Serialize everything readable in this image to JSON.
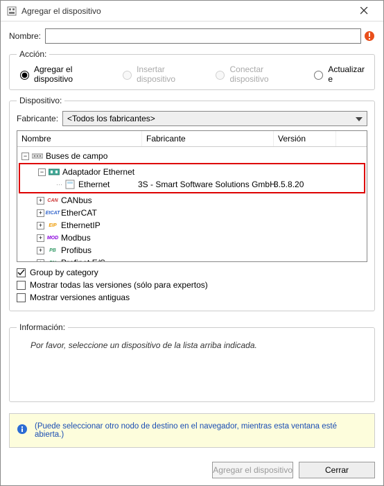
{
  "window": {
    "title": "Agregar el dispositivo"
  },
  "name": {
    "label": "Nombre:",
    "value": ""
  },
  "action": {
    "legend": "Acción:",
    "add": "Agregar el dispositivo",
    "insert": "Insertar dispositivo",
    "connect": "Conectar dispositivo",
    "update": "Actualizar e"
  },
  "device": {
    "legend": "Dispositivo:",
    "vendor_label": "Fabricante:",
    "vendor_value": "<Todos los fabricantes>",
    "cols": {
      "name": "Nombre",
      "vendor": "Fabricante",
      "version": "Versión"
    },
    "root": "Buses de campo",
    "eth_adapter": "Adaptador Ethernet",
    "eth": {
      "name": "Ethernet",
      "vendor": "3S - Smart Software Solutions GmbH",
      "version": "3.5.8.20"
    },
    "items": [
      "CANbus",
      "EtherCAT",
      "EthernetIP",
      "Modbus",
      "Profibus",
      "Profinet E/S"
    ],
    "icons": [
      "CAN",
      "EtCAT",
      "EIP",
      "MOD",
      "PB",
      "PN"
    ]
  },
  "checks": {
    "group": "Group by category",
    "allver": "Mostrar todas las versiones (sólo para expertos)",
    "oldver": "Mostrar versiones antiguas"
  },
  "info": {
    "legend": "Información:",
    "text": "Por favor, seleccione un dispositivo de la lista arriba indicada."
  },
  "hint": "(Puede seleccionar otro nodo de destino en el navegador, mientras esta ventana esté abierta.)",
  "buttons": {
    "add": "Agregar el dispositivo",
    "close": "Cerrar"
  }
}
